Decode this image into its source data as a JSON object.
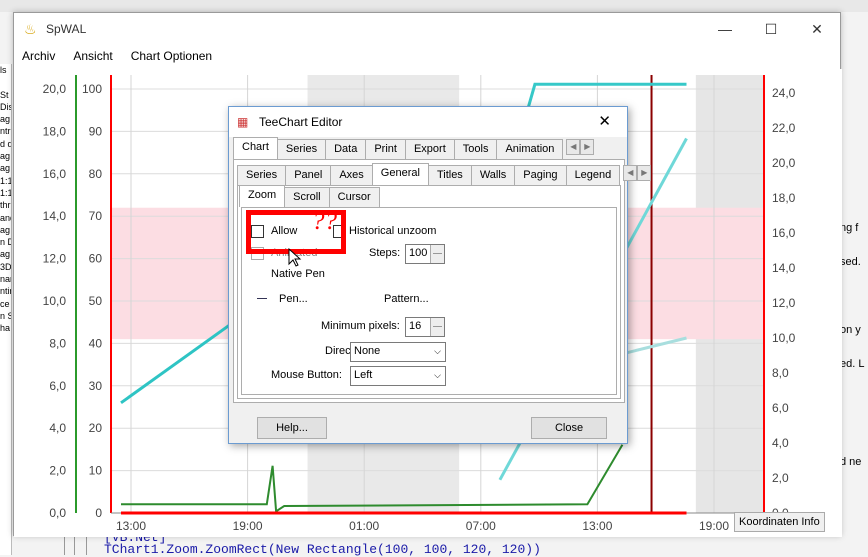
{
  "window": {
    "title": "SpWAL",
    "min": "—",
    "max": "☐",
    "close": "✕"
  },
  "menu": [
    "Archiv",
    "Ansicht",
    "Chart Optionen"
  ],
  "left_strip": [
    "ls",
    "",
    "St",
    "Disp",
    "ag",
    "ntr",
    "d de",
    "ag v",
    "ag v",
    "1:1",
    "1:1",
    "thr",
    "and",
    "ag u",
    "n D",
    "ag C",
    "3D",
    "nar",
    "ntir",
    "ce",
    "n S",
    "ha"
  ],
  "right_strip": [
    "ng f",
    "sed.",
    "on y",
    "ed. L",
    "d ne"
  ],
  "code": {
    "line1": "[VB.Net]",
    "line2": "TChart1.Zoom.ZoomRect(New Rectangle(100, 100, 120, 120))"
  },
  "chart_data": {
    "type": "line",
    "x_ticks": [
      "13:00",
      "19:00",
      "01:00",
      "07:00",
      "13:00",
      "19:00"
    ],
    "y_left_outer": {
      "ticks": [
        "0,0",
        "2,0",
        "4,0",
        "6,0",
        "8,0",
        "10,0",
        "12,0",
        "14,0",
        "16,0",
        "18,0",
        "20,0"
      ],
      "range": [
        0,
        20
      ]
    },
    "y_left_inner": {
      "ticks": [
        "0",
        "10",
        "20",
        "30",
        "40",
        "50",
        "60",
        "70",
        "80",
        "90",
        "100"
      ],
      "range": [
        0,
        100
      ]
    },
    "y_right": {
      "ticks": [
        "0,0",
        "2,0",
        "4,0",
        "6,0",
        "8,0",
        "10,0",
        "12,0",
        "14,0",
        "16,0",
        "18,0",
        "20,0",
        "22,0",
        "24,0"
      ],
      "range": [
        0,
        24
      ]
    },
    "band": {
      "y_from": 8.2,
      "y_to": 14.4,
      "color": "#fcdde3"
    },
    "series": [
      {
        "color": "#2ec4c4",
        "x": [
          0,
          1.3
        ],
        "y": [
          6.3,
          12.5
        ]
      },
      {
        "color": "#6fd8d8",
        "x": [
          3.25,
          4.85
        ],
        "y": [
          1.9,
          21.4
        ]
      },
      {
        "color": "#a8dede",
        "x": [
          4.0,
          4.85
        ],
        "y": [
          8.6,
          10.0
        ]
      },
      {
        "color": "#36c8c8",
        "x": [
          3.4,
          3.55,
          4.85
        ],
        "y": [
          21.0,
          24.5,
          24.5
        ]
      },
      {
        "color": "#2e8b2e",
        "x": [
          0,
          1.25,
          1.3,
          1.33,
          1.4,
          4.0,
          4.3
        ],
        "y": [
          0.5,
          0.5,
          2.7,
          0.1,
          0.4,
          0.5,
          3.9
        ]
      },
      {
        "color": "#ff0000",
        "x": [
          0,
          4.85
        ],
        "y": [
          0,
          0
        ]
      }
    ]
  },
  "koordinaten": "Koordinaten Info",
  "dialog": {
    "title": "TeeChart Editor",
    "close": "✕",
    "tabs1": [
      "Chart",
      "Series",
      "Data",
      "Print",
      "Export",
      "Tools",
      "Animation"
    ],
    "tabs2": [
      "Series",
      "Panel",
      "Axes",
      "General",
      "Titles",
      "Walls",
      "Paging",
      "Legend"
    ],
    "tabs3": [
      "Zoom",
      "Scroll",
      "Cursor"
    ],
    "allow": "Allow",
    "historical": "Historical unzoom",
    "animated": "Animated",
    "steps_label": "Steps:",
    "steps": "100",
    "native_pen": "Native Pen",
    "pen": "Pen...",
    "pattern": "Pattern...",
    "minpix_label": "Minimum pixels:",
    "minpix": "16",
    "direction_label": "Direction:",
    "direction": "None",
    "mouse_label": "Mouse Button:",
    "mouse": "Left",
    "help": "Help...",
    "close_btn": "Close"
  },
  "annotation": "??"
}
